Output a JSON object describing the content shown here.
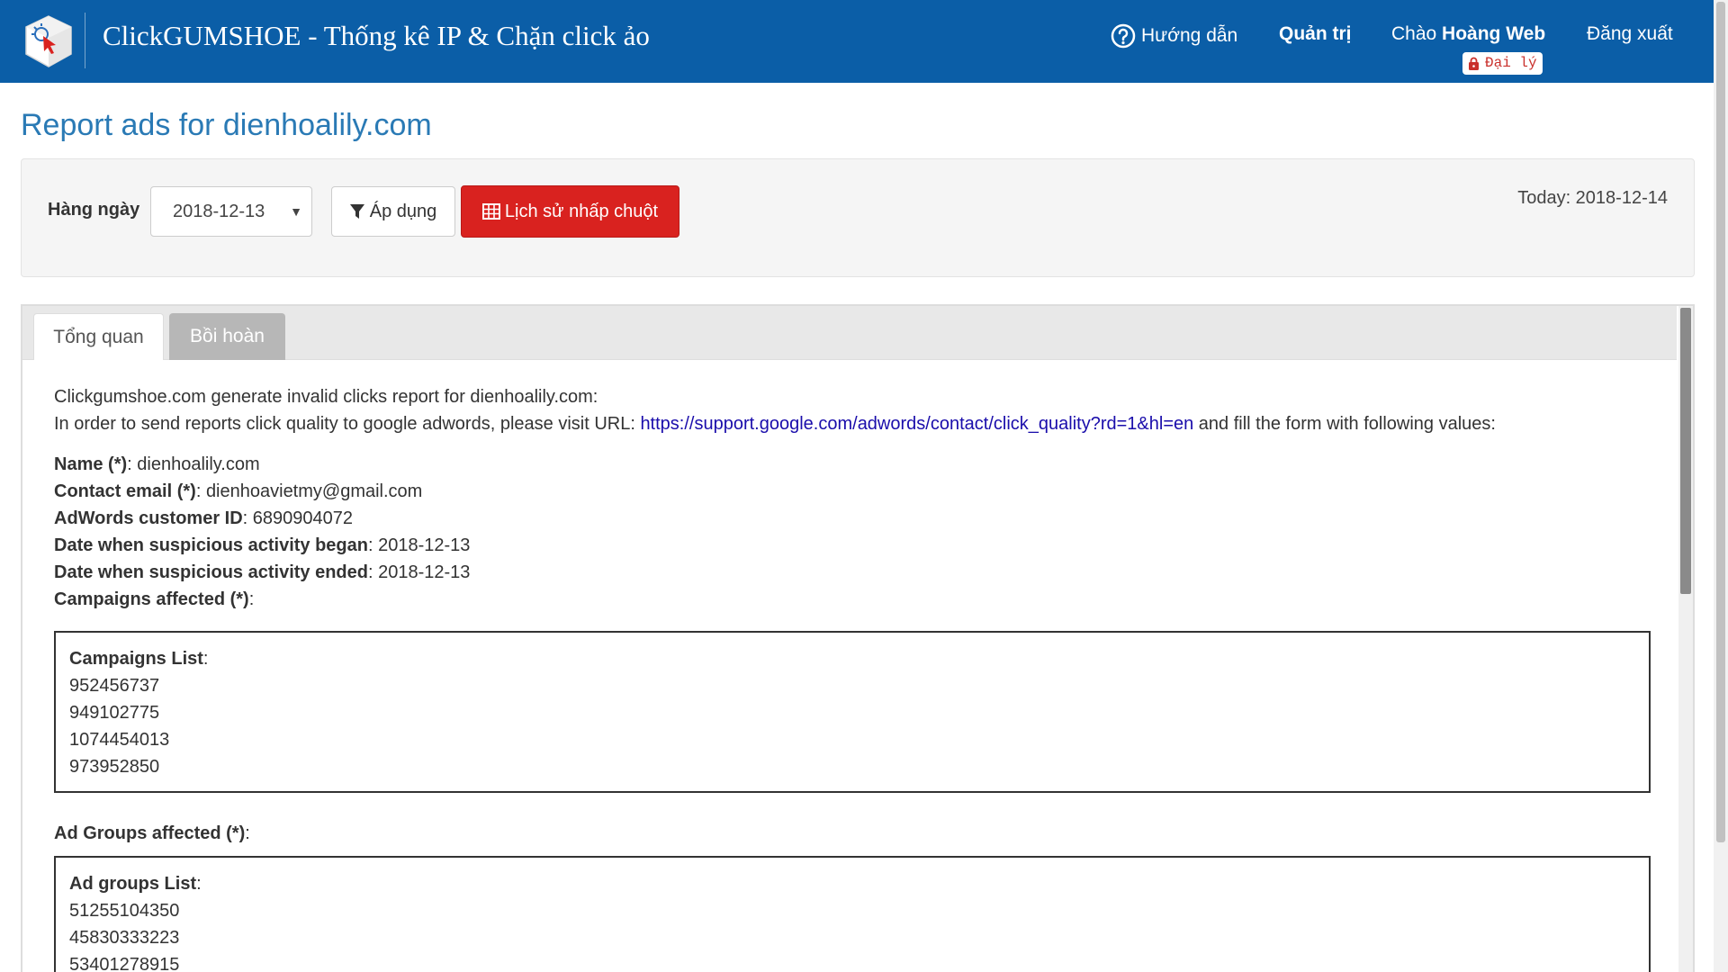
{
  "navbar": {
    "brand_title": "ClickGUMSHOE - Thống kê IP & Chặn click ảo",
    "help_label": "Hướng dẫn",
    "admin_label": "Quản trị",
    "greeting_prefix": "Chào ",
    "greeting_name": "Hoàng Web",
    "agent_badge": "Đại lý",
    "logout_label": "Đăng xuất",
    "bg_color": "#0b5ea7"
  },
  "page": {
    "title": "Report ads for dienhoalily.com"
  },
  "filter": {
    "period_label": "Hàng ngày",
    "selected_date": "2018-12-13",
    "apply_label": "Áp dụng",
    "history_label": "Lịch sử nhấp chuột",
    "history_color": "#d9221f",
    "today_text": "Today: 2018-12-14"
  },
  "tabs": [
    {
      "label": "Tổng quan",
      "active": false
    },
    {
      "label": "Bồi hoàn",
      "active": true
    }
  ],
  "report": {
    "intro": "Clickgumshoe.com generate invalid clicks report for dienhoalily.com:",
    "instruction_prefix": "In order to send reports click quality to google adwords, please visit URL: ",
    "instruction_url": "https://support.google.com/adwords/contact/click_quality?rd=1&hl=en",
    "instruction_suffix": " and fill the form with following values:",
    "fields": [
      {
        "label": "Name (*)",
        "value": "dienhoalily.com"
      },
      {
        "label": "Contact email (*)",
        "value": "dienhoavietmy@gmail.com"
      },
      {
        "label": "AdWords customer ID",
        "value": "6890904072"
      },
      {
        "label": "Date when suspicious activity began",
        "value": "2018-12-13"
      },
      {
        "label": "Date when suspicious activity ended",
        "value": "2018-12-13"
      },
      {
        "label": "Campaigns affected (*)",
        "value": ""
      }
    ],
    "campaigns_list_label": "Campaigns List",
    "campaigns": [
      "952456737",
      "949102775",
      "1074454013",
      "973952850"
    ],
    "ad_groups_affected_label": "Ad Groups affected (*)",
    "ad_groups_list_label": "Ad groups List",
    "ad_groups": [
      "51255104350",
      "45830333223",
      "53401278915"
    ]
  }
}
